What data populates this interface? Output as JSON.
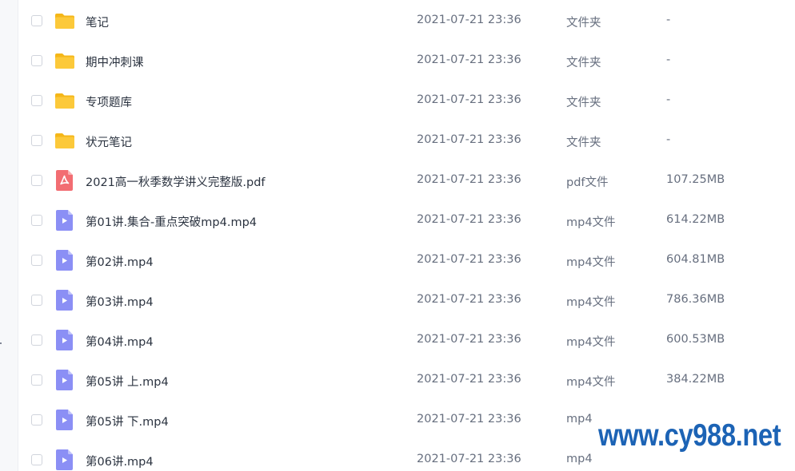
{
  "files": [
    {
      "name": "笔记",
      "date": "2021-07-21 23:36",
      "type": "文件夹",
      "size": "-",
      "icon": "folder-icon"
    },
    {
      "name": "期中冲刺课",
      "date": "2021-07-21 23:36",
      "type": "文件夹",
      "size": "-",
      "icon": "folder-icon"
    },
    {
      "name": "专项题库",
      "date": "2021-07-21 23:36",
      "type": "文件夹",
      "size": "-",
      "icon": "folder-icon"
    },
    {
      "name": "状元笔记",
      "date": "2021-07-21 23:36",
      "type": "文件夹",
      "size": "-",
      "icon": "folder-icon"
    },
    {
      "name": "2021高一秋季数学讲义完整版.pdf",
      "date": "2021-07-21 23:36",
      "type": "pdf文件",
      "size": "107.25MB",
      "icon": "pdf-icon"
    },
    {
      "name": "第01讲.集合-重点突破mp4.mp4",
      "date": "2021-07-21 23:36",
      "type": "mp4文件",
      "size": "614.22MB",
      "icon": "video-icon"
    },
    {
      "name": "第02讲.mp4",
      "date": "2021-07-21 23:36",
      "type": "mp4文件",
      "size": "604.81MB",
      "icon": "video-icon"
    },
    {
      "name": "第03讲.mp4",
      "date": "2021-07-21 23:36",
      "type": "mp4文件",
      "size": "786.36MB",
      "icon": "video-icon"
    },
    {
      "name": "第04讲.mp4",
      "date": "2021-07-21 23:36",
      "type": "mp4文件",
      "size": "600.53MB",
      "icon": "video-icon"
    },
    {
      "name": "第05讲 上.mp4",
      "date": "2021-07-21 23:36",
      "type": "mp4文件",
      "size": "384.22MB",
      "icon": "video-icon"
    },
    {
      "name": "第05讲 下.mp4",
      "date": "2021-07-21 23:36",
      "type": "mp4",
      "size": "",
      "icon": "video-icon"
    },
    {
      "name": "第06讲.mp4",
      "date": "2021-07-21 23:36",
      "type": "mp4",
      "size": "",
      "icon": "video-icon"
    }
  ],
  "watermark": {
    "text": "www.cy988.net"
  },
  "colors": {
    "folder": "#fcc93a",
    "folder_tab": "#f5b719",
    "pdf": "#f26d72",
    "video": "#8b8ff5",
    "watermark": "#1c63b5"
  }
}
